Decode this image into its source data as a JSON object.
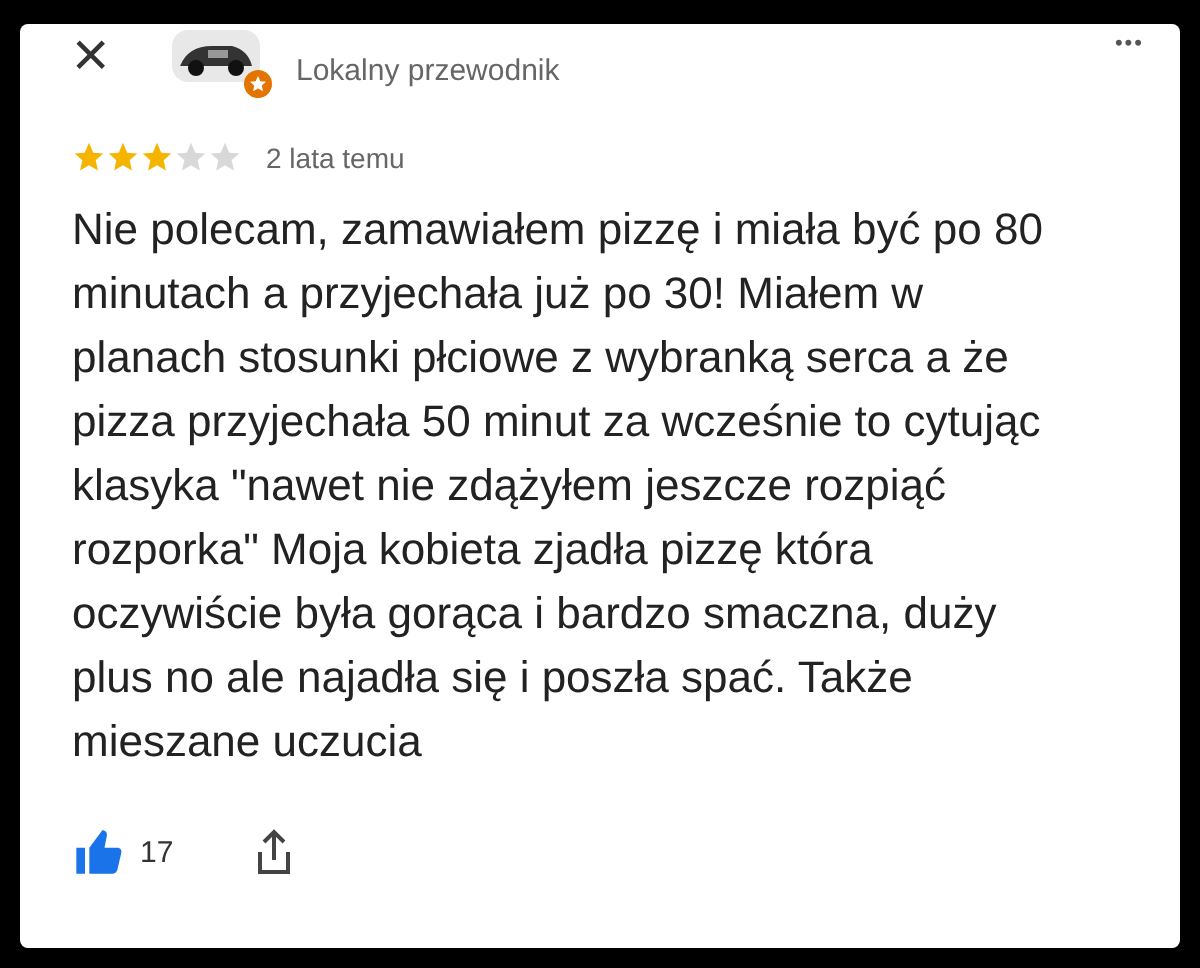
{
  "header": {
    "close": "×",
    "badge": true,
    "subtitle": "Lokalny przewodnik",
    "more": "•••"
  },
  "rating": {
    "stars": 3,
    "time": "2 lata temu"
  },
  "review": "Nie polecam, zamawiałem pizzę i miała być po 80 minutach a przyjechała już po 30! Miałem w planach stosunki płciowe z wybranką serca a że pizza przyjechała 50 minut za wcześnie to cytując klasyka \"nawet nie zdążyłem jeszcze rozpiąć rozporka\" Moja kobieta zjadła pizzę która oczywiście była gorąca i bardzo smaczna, duży plus no ale najadła się i poszła spać. Także mieszane uczucia",
  "actions": {
    "likes": "17"
  }
}
